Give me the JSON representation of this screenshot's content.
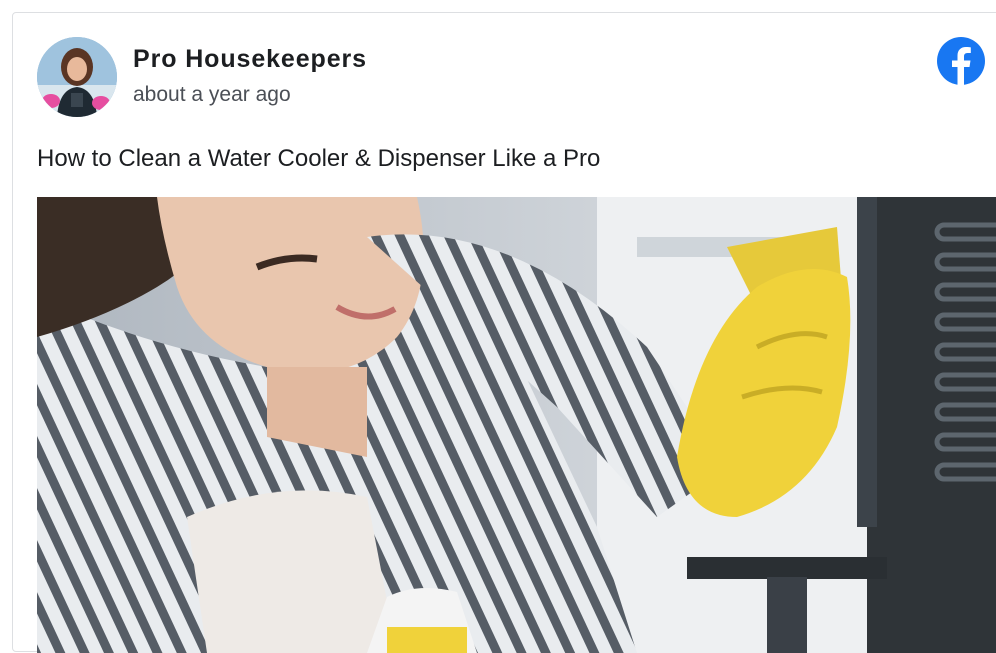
{
  "post": {
    "author_name": "Pro Housekeepers",
    "timestamp": "about a year ago",
    "title": "How to Clean a Water Cooler & Dispenser Like a Pro",
    "platform_icon": "facebook-icon",
    "avatar_icon": "profile-photo",
    "image_subject": "cleaning-photo"
  },
  "colors": {
    "facebook_blue": "#1877f2",
    "glove_yellow": "#f0d23a",
    "dispenser_dark": "#2f3438"
  }
}
